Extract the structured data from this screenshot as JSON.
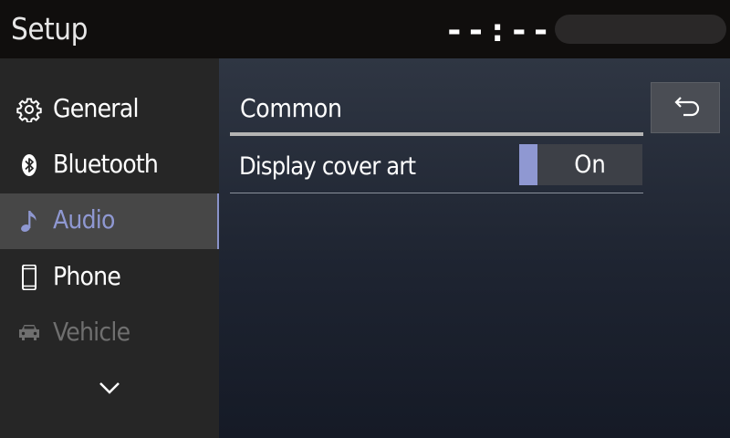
{
  "header": {
    "title": "Setup",
    "clock": "--:--"
  },
  "sidebar": {
    "items": [
      {
        "label": "General",
        "icon": "gear-icon",
        "state": "normal"
      },
      {
        "label": "Bluetooth",
        "icon": "bluetooth-icon",
        "state": "normal"
      },
      {
        "label": "Audio",
        "icon": "music-note-icon",
        "state": "active"
      },
      {
        "label": "Phone",
        "icon": "phone-icon",
        "state": "normal"
      },
      {
        "label": "Vehicle",
        "icon": "car-icon",
        "state": "disabled"
      }
    ],
    "scroll_icon": "chevron-down-icon"
  },
  "main": {
    "section_title": "Common",
    "back_icon": "back-arrow-icon",
    "settings": [
      {
        "label": "Display cover art",
        "value": "On"
      }
    ]
  },
  "colors": {
    "accent": "#8f98d2",
    "sidebar_bg": "#262626",
    "sidebar_active_bg": "#474747",
    "header_bg": "#100e0d",
    "disabled_text": "#6f6f6f"
  }
}
